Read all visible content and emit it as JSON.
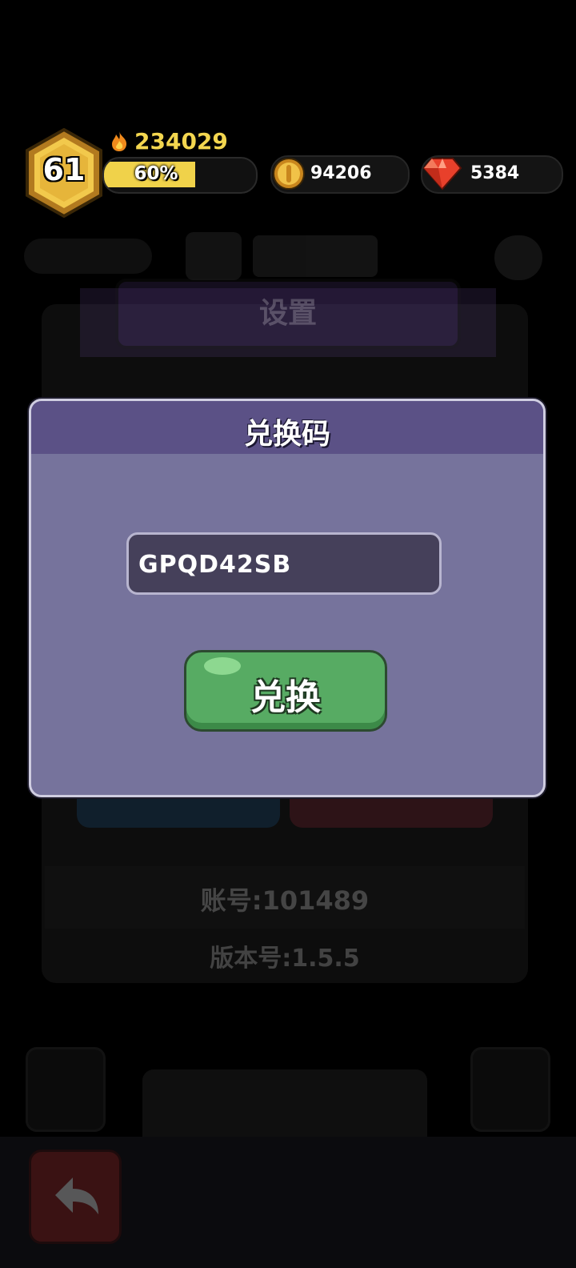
{
  "hud": {
    "level": "61",
    "power": "234029",
    "xp_percent_label": "60%",
    "xp_fraction": 0.6,
    "gold": "94206",
    "gems": "5384"
  },
  "background": {
    "settings_title": "设置",
    "account_label": "账号:101489",
    "version_label": "版本号:1.5.5"
  },
  "dialog": {
    "title": "兑换码",
    "code_value": "GPQD42SB",
    "redeem_label": "兑换"
  },
  "colors": {
    "dialog_body": "#76739c",
    "dialog_header": "#5b5186",
    "redeem_button": "#57ab63",
    "xp_bar": "#f0d24a",
    "power_text": "#f3d64f"
  },
  "icons": [
    "flame-icon",
    "gold-coin-icon",
    "gem-icon",
    "level-hexagon-icon",
    "back-arrow-icon"
  ]
}
